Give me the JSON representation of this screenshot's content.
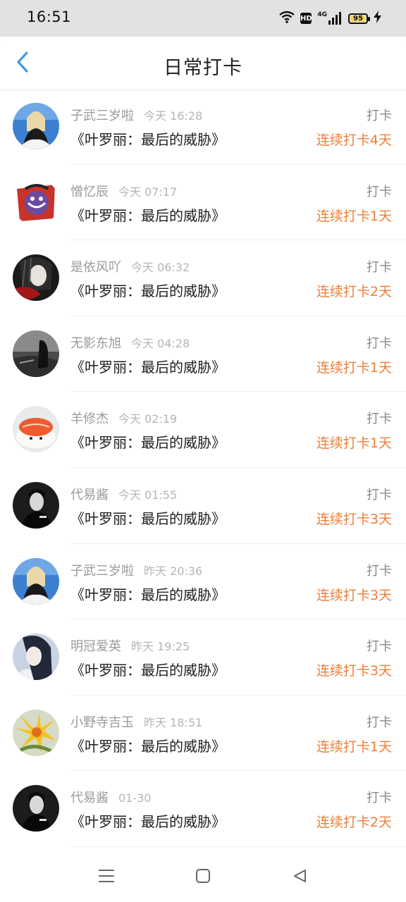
{
  "status_bar": {
    "time": "16:51",
    "hd_label": "HD",
    "network_label": "4G",
    "battery_level": "95",
    "battery_fraction": 0.95,
    "icons": [
      "wifi-icon",
      "hd-icon",
      "signal-icon",
      "battery-icon",
      "charging-icon"
    ]
  },
  "header": {
    "title": "日常打卡",
    "back_icon": "chevron-left-icon",
    "accent_color": "#3a9be5"
  },
  "colors": {
    "streak": "#f07d34",
    "username": "#9a9a9a",
    "timestamp": "#b5b5b5"
  },
  "checkins": [
    {
      "user": "子武三岁啦",
      "time": "今天 16:28",
      "book": "《叶罗丽：最后的威胁》",
      "action": "打卡",
      "streak": "连续打卡4天"
    },
    {
      "user": "憎忆辰",
      "time": "今天 07:17",
      "book": "《叶罗丽：最后的威胁》",
      "action": "打卡",
      "streak": "连续打卡1天"
    },
    {
      "user": "是依风吖",
      "time": "今天 06:32",
      "book": "《叶罗丽：最后的威胁》",
      "action": "打卡",
      "streak": "连续打卡2天"
    },
    {
      "user": "无影东旭",
      "time": "今天 04:28",
      "book": "《叶罗丽：最后的威胁》",
      "action": "打卡",
      "streak": "连续打卡1天"
    },
    {
      "user": "羊修杰",
      "time": "今天 02:19",
      "book": "《叶罗丽：最后的威胁》",
      "action": "打卡",
      "streak": "连续打卡1天"
    },
    {
      "user": "代易酱",
      "time": "今天 01:55",
      "book": "《叶罗丽：最后的威胁》",
      "action": "打卡",
      "streak": "连续打卡3天"
    },
    {
      "user": "子武三岁啦",
      "time": "昨天 20:36",
      "book": "《叶罗丽：最后的威胁》",
      "action": "打卡",
      "streak": "连续打卡3天"
    },
    {
      "user": "明冠爱英",
      "time": "昨天 19:25",
      "book": "《叶罗丽：最后的威胁》",
      "action": "打卡",
      "streak": "连续打卡3天"
    },
    {
      "user": "小野寺吉玉",
      "time": "昨天 18:51",
      "book": "《叶罗丽：最后的威胁》",
      "action": "打卡",
      "streak": "连续打卡1天"
    },
    {
      "user": "代易酱",
      "time": "01-30",
      "book": "《叶罗丽：最后的威胁》",
      "action": "打卡",
      "streak": "连续打卡2天"
    }
  ],
  "nav_bar": {
    "icons": [
      "menu-icon",
      "home-square-icon",
      "back-triangle-icon"
    ]
  }
}
